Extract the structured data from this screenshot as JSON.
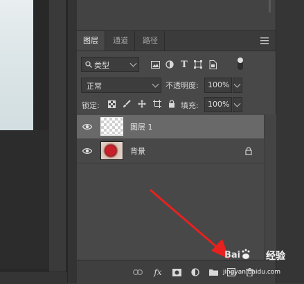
{
  "tabs": [
    {
      "label": "图层",
      "active": true
    },
    {
      "label": "通道",
      "active": false
    },
    {
      "label": "路径",
      "active": false
    }
  ],
  "filter": {
    "label": "类型"
  },
  "blend": {
    "mode": "正常",
    "opacity_label": "不透明度:",
    "opacity_value": "100%"
  },
  "lock": {
    "label": "锁定:",
    "fill_label": "填充:",
    "fill_value": "100%"
  },
  "layers": [
    {
      "name": "图层 1",
      "selected": true
    },
    {
      "name": "背景",
      "selected": false,
      "locked": true
    }
  ],
  "bottom_icons": [
    "link-icon",
    "fx-icon",
    "mask-icon",
    "adjustment-icon",
    "folder-icon",
    "new-layer-icon",
    "trash-icon"
  ],
  "bottom_labels": {
    "fx": "fx"
  },
  "watermark": {
    "brand": "Baidu",
    "text1": "经验",
    "text2": "jingyan.baidu.com"
  },
  "colors": {
    "panel": "#484848",
    "selected_row": "#696969",
    "arrow": "#e8211f"
  }
}
